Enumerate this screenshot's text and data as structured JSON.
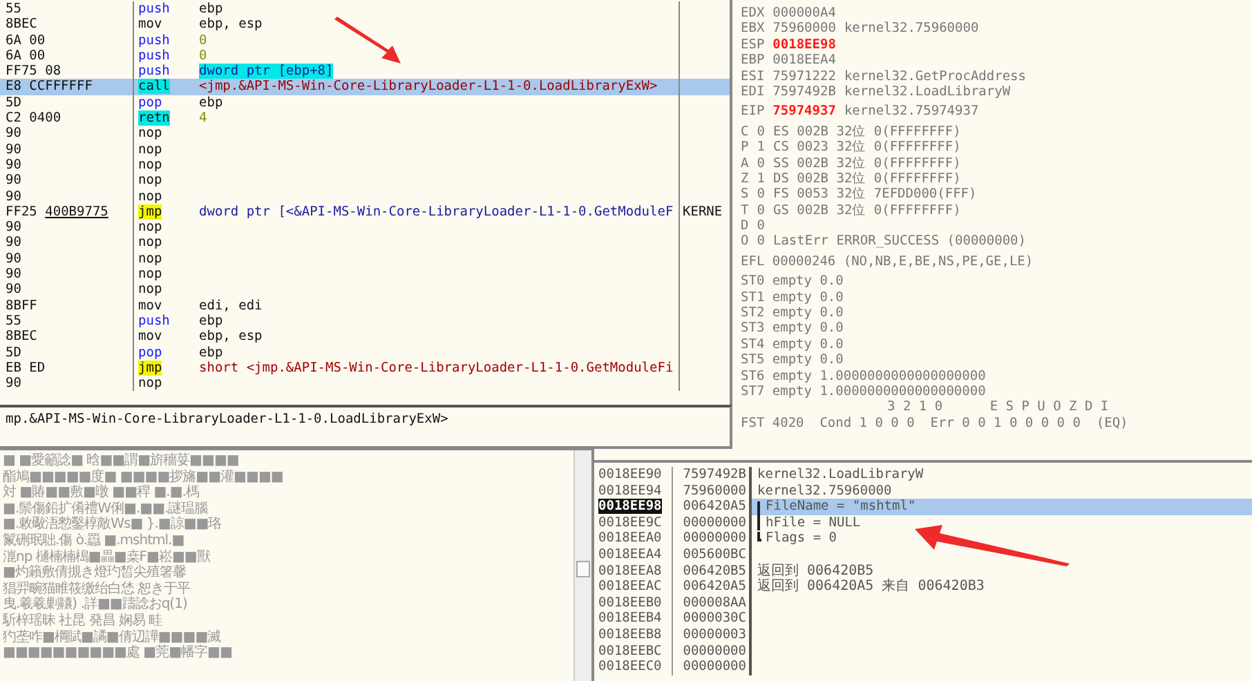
{
  "disassembly": {
    "rows": [
      {
        "hex": "55",
        "mnemonic": {
          "text": "push",
          "kind": "blue"
        },
        "operands": {
          "text": "ebp",
          "kind": "plain"
        },
        "selected": false
      },
      {
        "hex": "8BEC",
        "mnemonic": {
          "text": "mov",
          "kind": "plain"
        },
        "operands": {
          "text": "ebp, esp",
          "kind": "plain"
        },
        "selected": false
      },
      {
        "hex": "6A 00",
        "mnemonic": {
          "text": "push",
          "kind": "blue"
        },
        "operands": {
          "text": "0",
          "kind": "number"
        },
        "selected": false
      },
      {
        "hex": "6A 00",
        "mnemonic": {
          "text": "push",
          "kind": "blue"
        },
        "operands": {
          "text": "0",
          "kind": "number"
        },
        "selected": false
      },
      {
        "hex": "FF75 08",
        "mnemonic": {
          "text": "push",
          "kind": "blue"
        },
        "operands": {
          "text": "dword ptr [ebp+8]",
          "kind": "memory"
        },
        "selected": false
      },
      {
        "hex": "E8 CCFFFFFF",
        "mnemonic": {
          "text": "call",
          "kind": "cyan"
        },
        "operands": {
          "text": "<jmp.&API-MS-Win-Core-LibraryLoader-L1-1-0.LoadLibraryExW>",
          "kind": "target"
        },
        "selected": true
      },
      {
        "hex": "5D",
        "mnemonic": {
          "text": "pop",
          "kind": "blue"
        },
        "operands": {
          "text": "ebp",
          "kind": "plain"
        },
        "selected": false
      },
      {
        "hex": "C2 0400",
        "mnemonic": {
          "text": "retn",
          "kind": "cyan"
        },
        "operands": {
          "text": "4",
          "kind": "number"
        },
        "selected": false
      },
      {
        "hex": "90",
        "mnemonic": {
          "text": "nop",
          "kind": "plain"
        },
        "selected": false
      },
      {
        "hex": "90",
        "mnemonic": {
          "text": "nop",
          "kind": "plain"
        },
        "selected": false
      },
      {
        "hex": "90",
        "mnemonic": {
          "text": "nop",
          "kind": "plain"
        },
        "selected": false
      },
      {
        "hex": "90",
        "mnemonic": {
          "text": "nop",
          "kind": "plain"
        },
        "selected": false
      },
      {
        "hex": "90",
        "mnemonic": {
          "text": "nop",
          "kind": "plain"
        },
        "selected": false
      },
      {
        "hex": "FF25",
        "fixup": "400B9775",
        "mnemonic": {
          "text": "jmp",
          "kind": "yellow"
        },
        "operands": {
          "text": "dword ptr [<&API-MS-Win-Core-LibraryLoader-L1-1-0.GetModuleF",
          "kind": "import"
        },
        "comment": "KERNE",
        "selected": false
      },
      {
        "hex": "90",
        "mnemonic": {
          "text": "nop",
          "kind": "plain"
        },
        "selected": false
      },
      {
        "hex": "90",
        "mnemonic": {
          "text": "nop",
          "kind": "plain"
        },
        "selected": false
      },
      {
        "hex": "90",
        "mnemonic": {
          "text": "nop",
          "kind": "plain"
        },
        "selected": false
      },
      {
        "hex": "90",
        "mnemonic": {
          "text": "nop",
          "kind": "plain"
        },
        "selected": false
      },
      {
        "hex": "90",
        "mnemonic": {
          "text": "nop",
          "kind": "plain"
        },
        "selected": false
      },
      {
        "hex": "8BFF",
        "mnemonic": {
          "text": "mov",
          "kind": "plain"
        },
        "operands": {
          "text": "edi, edi",
          "kind": "plain"
        },
        "selected": false
      },
      {
        "hex": "55",
        "mnemonic": {
          "text": "push",
          "kind": "blue"
        },
        "operands": {
          "text": "ebp",
          "kind": "plain"
        },
        "selected": false
      },
      {
        "hex": "8BEC",
        "mnemonic": {
          "text": "mov",
          "kind": "plain"
        },
        "operands": {
          "text": "ebp, esp",
          "kind": "plain"
        },
        "selected": false
      },
      {
        "hex": "5D",
        "mnemonic": {
          "text": "pop",
          "kind": "blue"
        },
        "operands": {
          "text": "ebp",
          "kind": "plain"
        },
        "selected": false
      },
      {
        "hex": "EB ED",
        "mnemonic": {
          "text": "jmp",
          "kind": "yellow"
        },
        "operands": {
          "text": "short <jmp.&API-MS-Win-Core-LibraryLoader-L1-1-0.GetModuleFi",
          "kind": "target"
        },
        "selected": false
      },
      {
        "hex": "90",
        "mnemonic": {
          "text": "nop",
          "kind": "plain"
        },
        "selected": false
      }
    ]
  },
  "info_line": "mp.&API-MS-Win-Core-LibraryLoader-L1-1-0.LoadLibraryExW>",
  "registers": {
    "general": [
      {
        "name": "EDX",
        "value": "000000A4",
        "changed": false
      },
      {
        "name": "EBX",
        "value": "75960000",
        "comment": "kernel32.75960000",
        "changed": false
      },
      {
        "name": "ESP",
        "value": "0018EE98",
        "changed": true
      },
      {
        "name": "EBP",
        "value": "0018EEA4",
        "changed": false
      },
      {
        "name": "ESI",
        "value": "75971222",
        "comment": "kernel32.GetProcAddress",
        "changed": false
      },
      {
        "name": "EDI",
        "value": "7597492B",
        "comment": "kernel32.LoadLibraryW",
        "changed": false
      }
    ],
    "eip": {
      "name": "EIP",
      "value": "75974937",
      "comment": "kernel32.75974937",
      "changed": true
    },
    "flags": [
      {
        "flag": "C",
        "bit": "0",
        "detail": "ES 002B 32位 0(FFFFFFFF)"
      },
      {
        "flag": "P",
        "bit": "1",
        "detail": "CS 0023 32位 0(FFFFFFFF)"
      },
      {
        "flag": "A",
        "bit": "0",
        "detail": "SS 002B 32位 0(FFFFFFFF)"
      },
      {
        "flag": "Z",
        "bit": "1",
        "detail": "DS 002B 32位 0(FFFFFFFF)"
      },
      {
        "flag": "S",
        "bit": "0",
        "detail": "FS 0053 32位 7EFDD000(FFF)"
      },
      {
        "flag": "T",
        "bit": "0",
        "detail": "GS 002B 32位 0(FFFFFFFF)"
      },
      {
        "flag": "D",
        "bit": "0"
      },
      {
        "flag": "O",
        "bit": "0",
        "detail": "LastErr ERROR_SUCCESS (00000000)"
      }
    ],
    "efl": "EFL 00000246 (NO,NB,E,BE,NS,PE,GE,LE)",
    "fpu": [
      "ST0 empty 0.0",
      "ST1 empty 0.0",
      "ST2 empty 0.0",
      "ST3 empty 0.0",
      "ST4 empty 0.0",
      "ST5 empty 0.0",
      "ST6 empty 1.0000000000000000000",
      "ST7 empty 1.0000000000000000000"
    ],
    "fst_header": "3 2 1 0      E S P U O Z D I",
    "fst": "FST 4020  Cond 1 0 0 0  Err 0 0 1 0 0 0 0 0  (EQ)"
  },
  "dump": {
    "lines": [
      "■ ■愛籲諗■ 晗■■謂■旂穡荽■■■■",
      "酯鳩■■■■■度■ ■■■■拶旛■■灌■■■■",
      "対 ■賰■■敷■暾 ■■稈 ■.■.榪",
      "■.鬃傷鉛扩倄禮W俐■.■■.謎瑥腦",
      "■.敕礮浯愸鑿椁敵Ws■ }.■諒■■珞",
      "鬣硎珉聉.傷 ò.羉 ■.mshtml.■",
      "潉np 樋楠楠槝■畾■桒F■崧■■獸",
      "■灼籟敷倩摫き燈玓皙尖殖箸馨",
      "猖羿畹猫睢筱缴绐白恷 恕き于平",
      "曳.羲羲剿齉) .詳■■躊諗おq(1)",
      "馸梓瑶昧 社昆 発昌 娴易 畦",
      "犳垄咋■棡賦■譎■倩辺譁■■■■滅",
      "■■■■■■■■■■處 ■莞■幡字■■"
    ]
  },
  "stack": {
    "rows": [
      {
        "address": "0018EE90",
        "value": "7597492B",
        "comment": "kernel32.LoadLibraryW",
        "kind": "plain",
        "selected": false,
        "current": false
      },
      {
        "address": "0018EE94",
        "value": "75960000",
        "comment": "kernel32.75960000",
        "kind": "plain",
        "selected": false,
        "current": false
      },
      {
        "address": "0018EE98",
        "value": "006420A5",
        "comment": "FileName = \"mshtml\"",
        "kind": "arg_first",
        "selected": true,
        "current": true
      },
      {
        "address": "0018EE9C",
        "value": "00000000",
        "comment": "hFile = NULL",
        "kind": "arg",
        "selected": false,
        "current": false
      },
      {
        "address": "0018EEA0",
        "value": "00000000",
        "comment": "Flags = 0",
        "kind": "arg_last",
        "selected": false,
        "current": false
      },
      {
        "address": "0018EEA4",
        "value": "005600BC",
        "kind": "plain",
        "selected": false,
        "current": false
      },
      {
        "address": "0018EEA8",
        "value": "006420B5",
        "comment": "返回到 006420B5",
        "kind": "plain",
        "selected": false,
        "current": false
      },
      {
        "address": "0018EEAC",
        "value": "006420A5",
        "comment": "返回到 006420A5 来自 006420B3",
        "kind": "plain",
        "selected": false,
        "current": false
      },
      {
        "address": "0018EEB0",
        "value": "000008AA",
        "kind": "plain",
        "selected": false,
        "current": false
      },
      {
        "address": "0018EEB4",
        "value": "0000030C",
        "kind": "plain",
        "selected": false,
        "current": false
      },
      {
        "address": "0018EEB8",
        "value": "00000003",
        "kind": "plain",
        "selected": false,
        "current": false
      },
      {
        "address": "0018EEBC",
        "value": "00000000",
        "kind": "plain",
        "selected": false,
        "current": false
      },
      {
        "address": "0018EEC0",
        "value": "00000000",
        "kind": "plain",
        "selected": false,
        "current": false
      }
    ]
  }
}
